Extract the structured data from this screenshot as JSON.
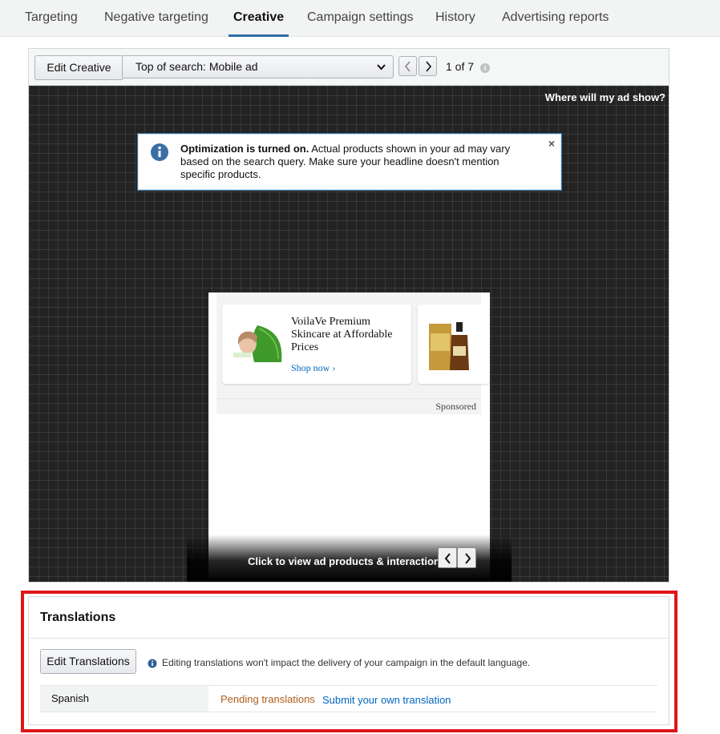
{
  "tabs": [
    {
      "label": "Targeting"
    },
    {
      "label": "Negative targeting"
    },
    {
      "label": "Creative"
    },
    {
      "label": "Campaign settings"
    },
    {
      "label": "History"
    },
    {
      "label": "Advertising reports"
    }
  ],
  "active_tab": "Creative",
  "creative": {
    "edit_button": "Edit Creative",
    "placement_select": "Top of search: Mobile ad",
    "pager": "1 of 7",
    "where_link": "Where will my ad show?",
    "alert": {
      "bold": "Optimization is turned on.",
      "text": " Actual products shown in your ad may vary based on the search query. Make sure your headline doesn't mention specific products.",
      "close": "×"
    },
    "ad": {
      "headline": "VoilaVe Premium Skincare at Affordable Prices",
      "cta": "Shop now",
      "sponsored": "Sponsored"
    },
    "view_bar_label": "Click to view ad products & interaction"
  },
  "translations": {
    "title": "Translations",
    "edit_button": "Edit Translations",
    "note": "Editing translations won't impact the delivery of your campaign in the default language.",
    "rows": [
      {
        "language": "Spanish",
        "status": "Pending translations",
        "action": "Submit your own translation"
      }
    ]
  },
  "colors": {
    "accent": "#2e6da4",
    "link": "#0066c0",
    "pending": "#b15c1a",
    "highlight_box": "#e0161a"
  }
}
